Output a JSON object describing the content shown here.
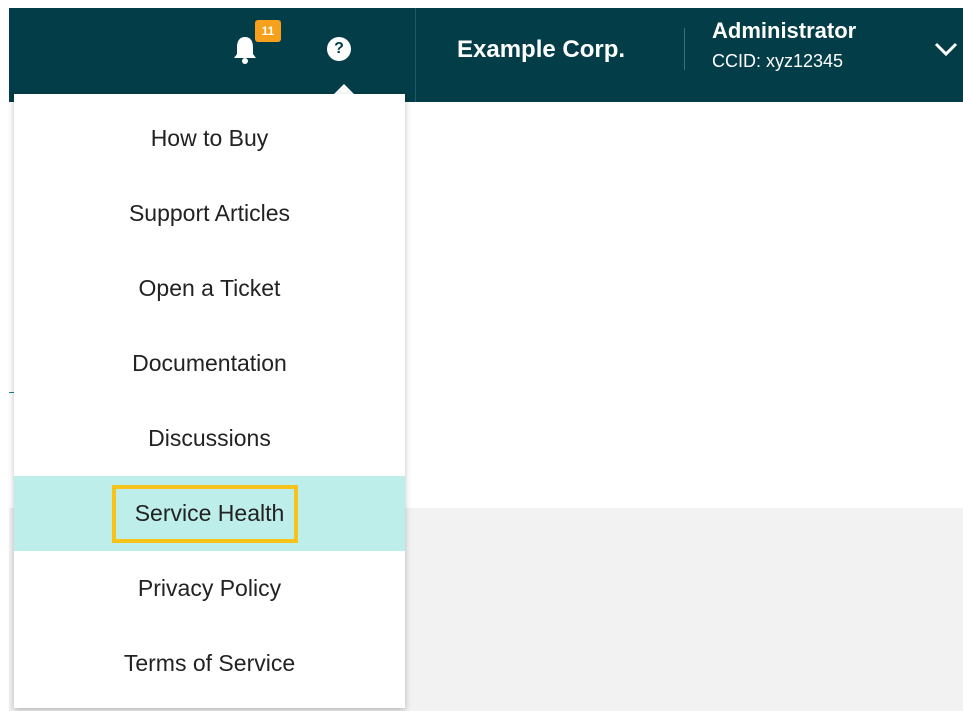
{
  "header": {
    "notification_count": "11",
    "help_symbol": "?",
    "org_name": "Example Corp.",
    "user_name": "Administrator",
    "customer_id": "CCID: xyz12345",
    "icons": [
      "bell-icon",
      "help-icon",
      "chevron-down-icon"
    ]
  },
  "help_menu": {
    "items": [
      {
        "label": "How to Buy"
      },
      {
        "label": "Support Articles"
      },
      {
        "label": "Open a Ticket"
      },
      {
        "label": "Documentation"
      },
      {
        "label": "Discussions"
      },
      {
        "label": "Service Health",
        "state": "hovered"
      },
      {
        "label": "Privacy Policy"
      },
      {
        "label": "Terms of Service"
      }
    ]
  },
  "colors": {
    "header_bg": "#033d47",
    "badge": "#f7a01c",
    "hover_bg": "#bdeeea",
    "highlight_border": "#f7c21a"
  }
}
